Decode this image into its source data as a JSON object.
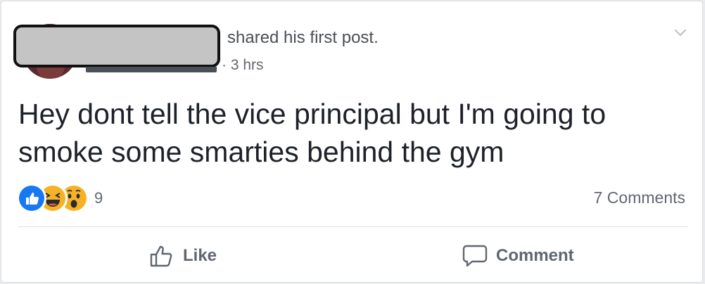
{
  "post": {
    "author_action": "shared his first post.",
    "meta_time": "· 3 hrs",
    "text": "Hey dont tell the vice principal but I'm going to smoke some smarties behind the gym"
  },
  "reactions": {
    "icons": [
      "like-icon",
      "haha-icon",
      "wow-icon"
    ],
    "count": "9"
  },
  "comments": {
    "count_label": "7 Comments"
  },
  "actions": {
    "like_label": "Like",
    "comment_label": "Comment"
  },
  "colors": {
    "like_blue": "#1877f2",
    "emoji_yellow": "#f7b125",
    "text_primary": "#1d2129",
    "text_secondary": "#616770"
  }
}
